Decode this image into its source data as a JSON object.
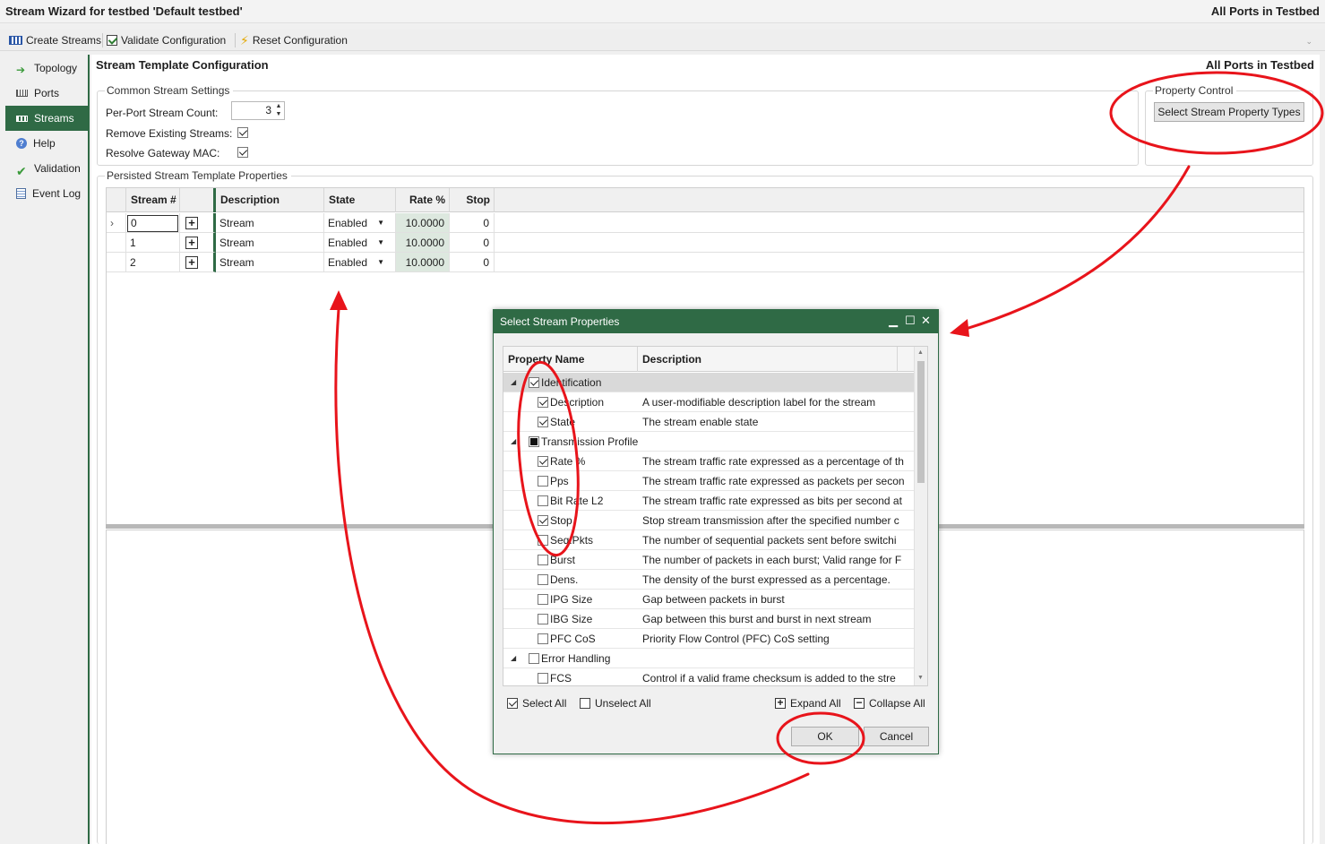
{
  "window": {
    "title": "Stream Wizard for testbed 'Default testbed'",
    "scope": "All Ports in Testbed"
  },
  "toolbar": {
    "create_streams": "Create Streams",
    "validate_configuration": "Validate Configuration",
    "reset_configuration": "Reset Configuration"
  },
  "sidebar": {
    "items": [
      {
        "label": "Topology",
        "icon": "arrow-right-icon"
      },
      {
        "label": "Ports",
        "icon": "ports-icon"
      },
      {
        "label": "Streams",
        "icon": "streams-icon",
        "active": true
      },
      {
        "label": "Help",
        "icon": "help-icon"
      },
      {
        "label": "Validation",
        "icon": "checkmark-icon"
      },
      {
        "label": "Event Log",
        "icon": "event-log-icon"
      }
    ]
  },
  "main": {
    "title": "Stream Template Configuration",
    "scope": "All Ports in Testbed",
    "common": {
      "group_label": "Common Stream Settings",
      "per_port_label": "Per-Port Stream Count:",
      "per_port_value": "3",
      "remove_label": "Remove Existing Streams:",
      "remove_checked": true,
      "resolve_label": "Resolve Gateway MAC:",
      "resolve_checked": true
    },
    "property_control": {
      "group_label": "Property Control",
      "button": "Select Stream Property Types"
    },
    "persisted": {
      "group_label": "Persisted Stream Template Properties",
      "columns": [
        "Stream #",
        "Description",
        "State",
        "Rate %",
        "Stop"
      ],
      "rows": [
        {
          "stream": "0",
          "description": "Stream",
          "state": "Enabled",
          "rate": "10.0000",
          "stop": "0"
        },
        {
          "stream": "1",
          "description": "Stream",
          "state": "Enabled",
          "rate": "10.0000",
          "stop": "0"
        },
        {
          "stream": "2",
          "description": "Stream",
          "state": "Enabled",
          "rate": "10.0000",
          "stop": "0"
        }
      ]
    }
  },
  "dialog": {
    "title": "Select Stream Properties",
    "columns": [
      "Property Name",
      "Description"
    ],
    "rows": [
      {
        "group": true,
        "name": "Identification",
        "state": "checked",
        "expanded": true
      },
      {
        "name": "Description",
        "checked": true,
        "desc": "A user-modifiable description label for the stream"
      },
      {
        "name": "State",
        "checked": true,
        "desc": "The stream enable state"
      },
      {
        "group": true,
        "name": "Transmission Profile",
        "state": "partial",
        "expanded": true
      },
      {
        "name": "Rate %",
        "checked": true,
        "desc": "The stream traffic rate expressed as a percentage of th"
      },
      {
        "name": "Pps",
        "checked": false,
        "desc": "The stream traffic rate expressed as packets per secon"
      },
      {
        "name": "Bit Rate L2",
        "checked": false,
        "desc": "The stream traffic rate expressed as bits per second at"
      },
      {
        "name": "Stop",
        "checked": true,
        "desc": "Stop stream transmission after the specified number c"
      },
      {
        "name": "Seq.Pkts",
        "checked": false,
        "desc": "The number of sequential packets sent before switchi"
      },
      {
        "name": "Burst",
        "checked": false,
        "desc": "The number of packets in each burst; Valid range for F"
      },
      {
        "name": "Dens.",
        "checked": false,
        "desc": "The density of the burst expressed as a percentage."
      },
      {
        "name": "IPG Size",
        "checked": false,
        "desc": "Gap between packets in burst"
      },
      {
        "name": "IBG Size",
        "checked": false,
        "desc": "Gap between this burst and burst in next stream"
      },
      {
        "name": "PFC CoS",
        "checked": false,
        "desc": "Priority Flow Control (PFC) CoS setting"
      },
      {
        "group": true,
        "name": "Error Handling",
        "state": "unchecked",
        "expanded": true
      },
      {
        "name": "FCS",
        "checked": false,
        "desc": "Control if a valid frame checksum is added to the stre"
      }
    ],
    "select_all": "Select All",
    "unselect_all": "Unselect All",
    "expand_all": "Expand All",
    "collapse_all": "Collapse All",
    "ok": "OK",
    "cancel": "Cancel"
  },
  "colors": {
    "accent": "#2f6a45",
    "annotation": "#e8141b",
    "rate_cell": "#dde8df"
  }
}
